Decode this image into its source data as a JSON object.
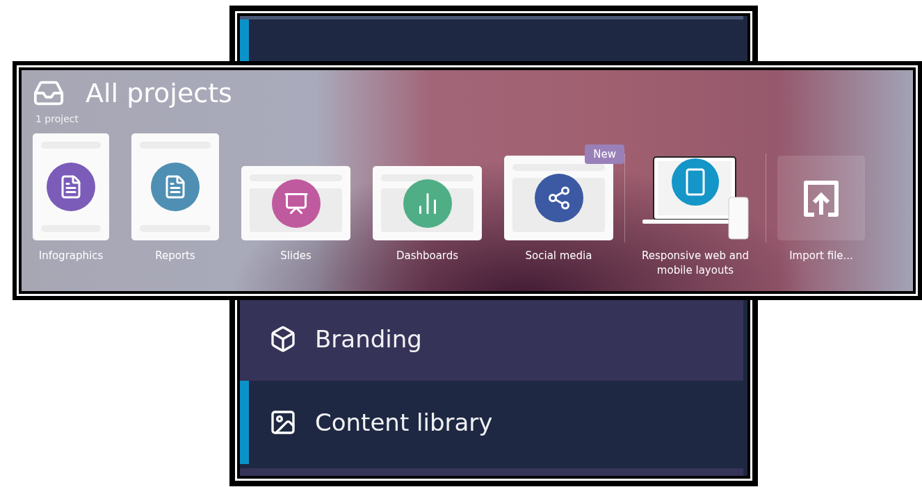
{
  "sidebar": {
    "items": [
      {
        "label": "Branding",
        "highlighted": true,
        "current": false
      },
      {
        "label": "Content library",
        "highlighted": false,
        "current": true
      }
    ]
  },
  "projects": {
    "title": "All projects",
    "count": "1 project",
    "templates": [
      {
        "label": "Infographics",
        "kind": "portrait",
        "color": "#7b5cb8"
      },
      {
        "label": "Reports",
        "kind": "portrait",
        "color": "#4f8fb3"
      },
      {
        "label": "Slides",
        "kind": "landscape",
        "color": "#c05a9e"
      },
      {
        "label": "Dashboards",
        "kind": "landscape",
        "color": "#4fae86"
      },
      {
        "label": "Social media",
        "kind": "landscape",
        "color": "#3b5aa3",
        "badge": "New"
      },
      {
        "label": "Responsive web and mobile layouts",
        "kind": "device",
        "color": "#1596c8"
      },
      {
        "label": "Import file...",
        "kind": "import"
      }
    ]
  }
}
